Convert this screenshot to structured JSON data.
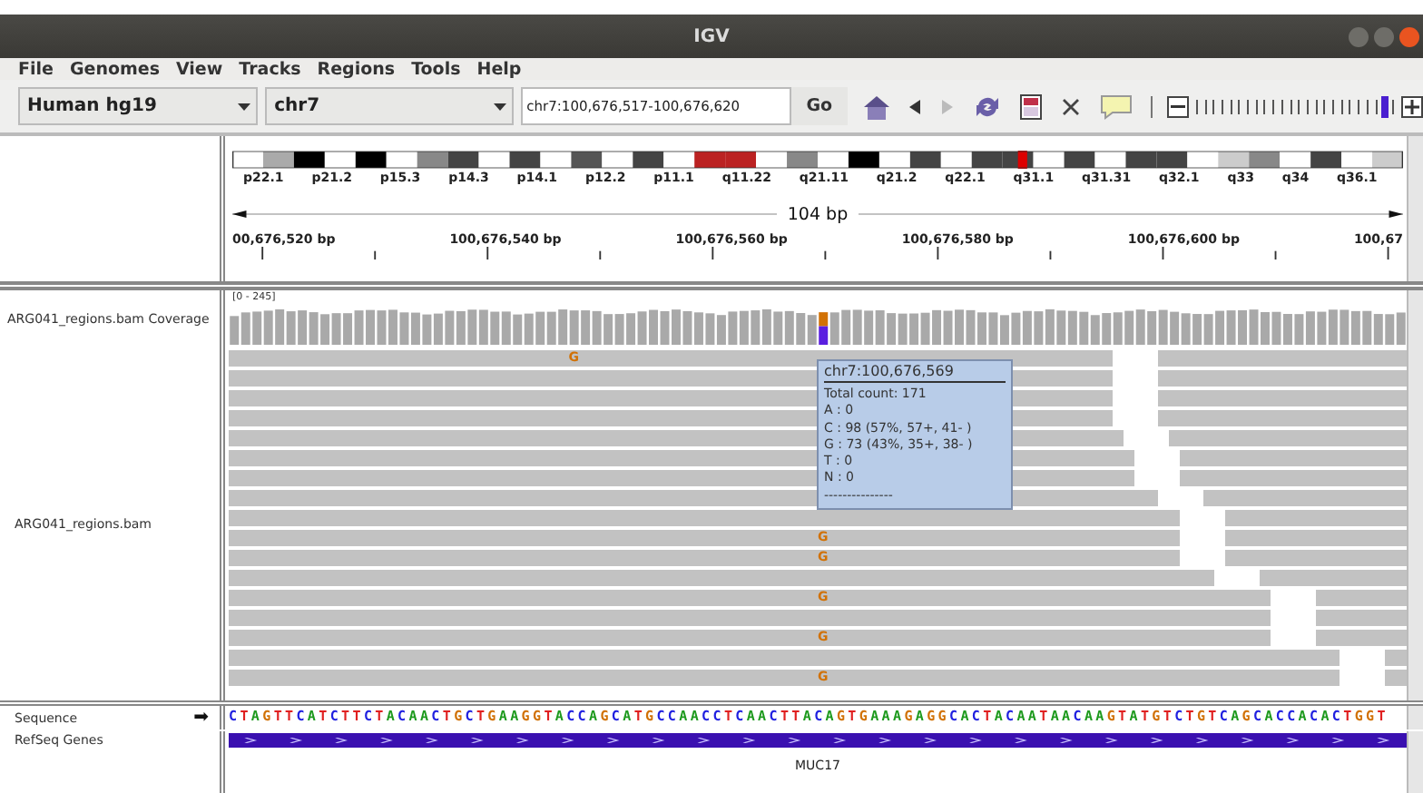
{
  "window": {
    "title": "IGV"
  },
  "menu": [
    "File",
    "Genomes",
    "View",
    "Tracks",
    "Regions",
    "Tools",
    "Help"
  ],
  "toolbar": {
    "genome": "Human hg19",
    "chromosome": "chr7",
    "locus": "chr7:100,676,517-100,676,620",
    "go": "Go",
    "zoom": {
      "level": 0.95
    }
  },
  "ideogram": {
    "bands": [
      "p22.1",
      "p21.2",
      "p15.3",
      "p14.3",
      "p14.1",
      "p12.2",
      "p11.1",
      "q11.22",
      "q21.11",
      "q21.2",
      "q22.1",
      "q31.1",
      "q31.31",
      "q32.1",
      "q33",
      "q34",
      "q36.1"
    ]
  },
  "ruler": {
    "span": "104 bp",
    "ticks": [
      "00,676,520 bp",
      "100,676,540 bp",
      "100,676,560 bp",
      "100,676,580 bp",
      "100,676,600 bp",
      "100,67"
    ]
  },
  "tracks": [
    {
      "kind": "coverage",
      "name": "ARG041_regions.bam Coverage",
      "range": "[0 - 245]"
    },
    {
      "kind": "alignment",
      "name": "ARG041_regions.bam",
      "mismatch_bases": [
        "G",
        "G",
        "G",
        "G",
        "G",
        "G"
      ]
    },
    {
      "kind": "sequence",
      "name": "Sequence",
      "arrow": "➡",
      "bases": "CTAGTTCATCTTCTACAACTGCTGAAGGTACCAGCATGCCAACCTCAACTTACAGTGAAAGAGGCACTACAATAACAAGTATGTCTGTCAGCACCACACTGGT"
    },
    {
      "kind": "gene",
      "name": "RefSeq Genes",
      "gene": "MUC17"
    }
  ],
  "tooltip": {
    "title": "chr7:100,676,569",
    "lines": [
      "Total count: 171",
      "A : 0",
      "C : 98 (57%, 57+, 41- )",
      "G : 73 (43%, 35+, 38- )",
      "T : 0",
      "N : 0",
      "---------------"
    ]
  }
}
